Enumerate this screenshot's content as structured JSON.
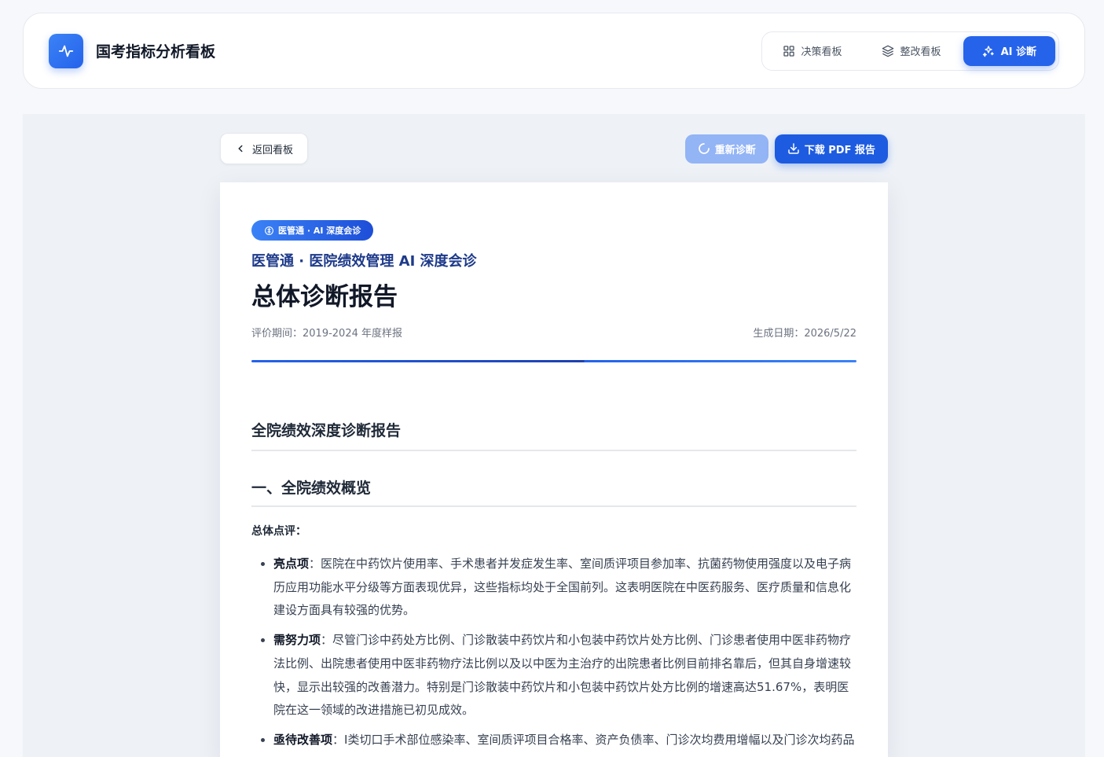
{
  "app": {
    "title": "国考指标分析看板"
  },
  "nav": {
    "tabs": [
      {
        "label": "决策看板",
        "icon": "grid-icon",
        "active": false
      },
      {
        "label": "整改看板",
        "icon": "layers-icon",
        "active": false
      },
      {
        "label": "AI 诊断",
        "icon": "sparkles-icon",
        "active": true
      }
    ]
  },
  "toolbar": {
    "back_label": "返回看板",
    "rediagnose_label": "重新诊断",
    "download_label": "下载 PDF 报告"
  },
  "report": {
    "badge": "医管通 · AI 深度会诊",
    "subtitle": "医管通 · 医院绩效管理 AI 深度会诊",
    "title": "总体诊断报告",
    "period": "评价期间：2019-2024 年度样报",
    "generated": "生成日期：2026/5/22",
    "h1": "全院绩效深度诊断报告",
    "h2": "一、全院绩效概览",
    "overall_label": "总体点评：",
    "points": [
      {
        "label": "亮点项",
        "text": "：医院在中药饮片使用率、手术患者并发症发生率、室间质评项目参加率、抗菌药物使用强度以及电子病历应用功能水平分级等方面表现优异，这些指标均处于全国前列。这表明医院在中医药服务、医疗质量和信息化建设方面具有较强的优势。"
      },
      {
        "label": "需努力项",
        "text": "：尽管门诊中药处方比例、门诊散装中药饮片和小包装中药饮片处方比例、门诊患者使用中医非药物疗法比例、出院患者使用中医非药物疗法比例以及以中医为主治疗的出院患者比例目前排名靠后，但其自身增速较快，显示出较强的改善潜力。特别是门诊散装中药饮片和小包装中药饮片处方比例的增速高达51.67%，表明医院在这一领域的改进措施已初见成效。"
      },
      {
        "label": "亟待改善项",
        "text": "：I类切口手术部位感染率、室间质评项目合格率、资产负债率、门诊次均费用增幅以及门诊次均药品费用增幅等指标处于全国末尾，且改善乏力或正在下滑，这些问题需要立即采取措施进行整改。"
      }
    ]
  },
  "colors": {
    "accent": "#2563eb",
    "subtitle": "#1e3a8a",
    "disabled_button": "#93b4f5"
  }
}
